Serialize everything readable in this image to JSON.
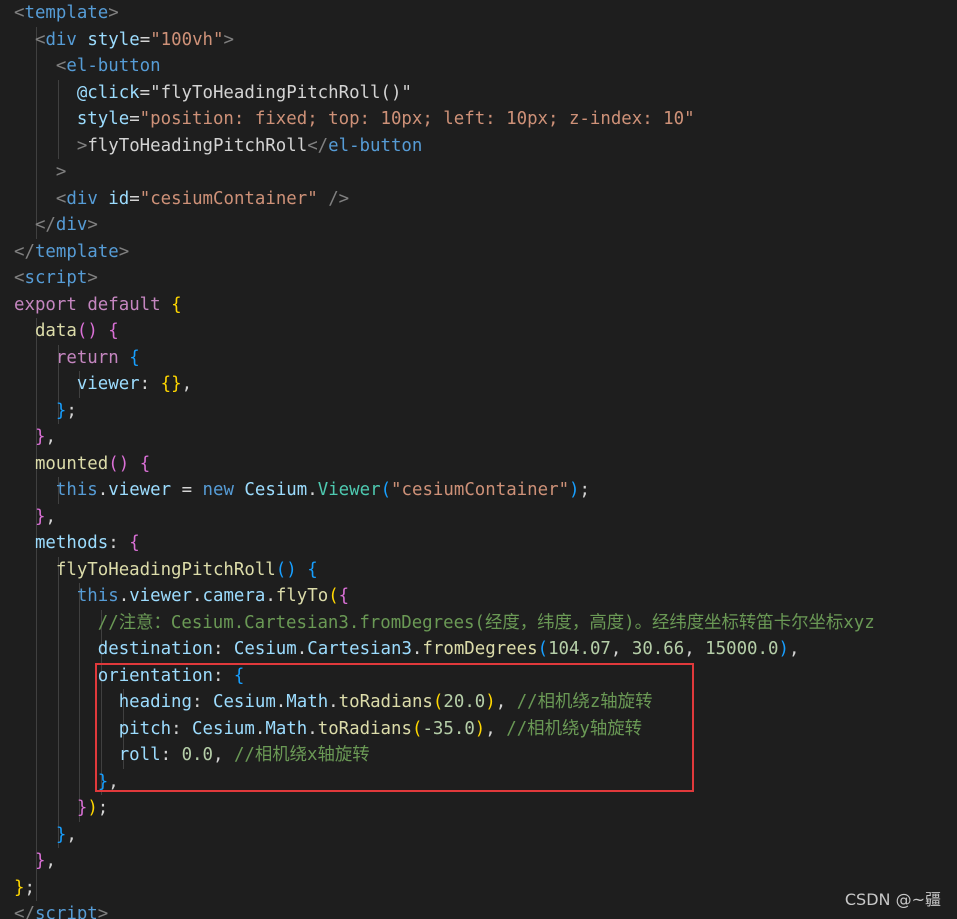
{
  "colors": {
    "background": "#1e1e1e",
    "tag_bracket": "#808080",
    "tag": "#569cd6",
    "attr": "#9cdcfe",
    "string": "#ce9178",
    "text": "#d4d4d4",
    "keyword": "#569cd6",
    "control": "#c586c0",
    "function": "#dcdcaa",
    "class": "#4ec9b0",
    "number": "#b5cea8",
    "comment": "#6a9955",
    "brace1": "#ffd700",
    "brace2": "#da70d6",
    "brace3": "#179fff",
    "highlight_border": "#e0393b"
  },
  "code_lines": [
    [
      [
        "<",
        "tag_bracket"
      ],
      [
        "template",
        "tag"
      ],
      [
        ">",
        "tag_bracket"
      ]
    ],
    [
      [
        "  "
      ],
      [
        "<",
        "tag_bracket"
      ],
      [
        "div",
        "tag"
      ],
      [
        " "
      ],
      [
        "style",
        "attr"
      ],
      [
        "=",
        "text"
      ],
      [
        "\"100vh\"",
        "string"
      ],
      [
        ">",
        "tag_bracket"
      ]
    ],
    [
      [
        "    "
      ],
      [
        "<",
        "tag_bracket"
      ],
      [
        "el-button",
        "tag"
      ]
    ],
    [
      [
        "      "
      ],
      [
        "@click",
        "attr"
      ],
      [
        "=",
        "text"
      ],
      [
        "\"flyToHeadingPitchRoll()\"",
        "text"
      ]
    ],
    [
      [
        "      "
      ],
      [
        "style",
        "attr"
      ],
      [
        "=",
        "text"
      ],
      [
        "\"position: fixed; top: 10px; left: 10px; z-index: 10\"",
        "string"
      ]
    ],
    [
      [
        "      "
      ],
      [
        ">",
        "tag_bracket"
      ],
      [
        "flyToHeadingPitchRoll",
        "text"
      ],
      [
        "</",
        "tag_bracket"
      ],
      [
        "el-button",
        "tag"
      ]
    ],
    [
      [
        "    "
      ],
      [
        ">",
        "tag_bracket"
      ]
    ],
    [
      [
        "    "
      ],
      [
        "<",
        "tag_bracket"
      ],
      [
        "div",
        "tag"
      ],
      [
        " "
      ],
      [
        "id",
        "attr"
      ],
      [
        "=",
        "text"
      ],
      [
        "\"cesiumContainer\"",
        "string"
      ],
      [
        " "
      ],
      [
        "/>",
        "tag_bracket"
      ]
    ],
    [
      [
        "  "
      ],
      [
        "</",
        "tag_bracket"
      ],
      [
        "div",
        "tag"
      ],
      [
        ">",
        "tag_bracket"
      ]
    ],
    [
      [
        "</",
        "tag_bracket"
      ],
      [
        "template",
        "tag"
      ],
      [
        ">",
        "tag_bracket"
      ]
    ],
    [
      [
        "<",
        "tag_bracket"
      ],
      [
        "script",
        "tag"
      ],
      [
        ">",
        "tag_bracket"
      ]
    ],
    [
      [
        "export",
        "control"
      ],
      [
        " "
      ],
      [
        "default",
        "control"
      ],
      [
        " "
      ],
      [
        "{",
        "brace1"
      ]
    ],
    [
      [
        "  "
      ],
      [
        "data",
        "function"
      ],
      [
        "()",
        "brace2"
      ],
      [
        " "
      ],
      [
        "{",
        "brace2"
      ]
    ],
    [
      [
        "    "
      ],
      [
        "return",
        "control"
      ],
      [
        " "
      ],
      [
        "{",
        "brace3"
      ]
    ],
    [
      [
        "      "
      ],
      [
        "viewer",
        "attr"
      ],
      [
        ":",
        "text"
      ],
      [
        " "
      ],
      [
        "{}",
        "brace1"
      ],
      [
        ",",
        "text"
      ]
    ],
    [
      [
        "    "
      ],
      [
        "}",
        "brace3"
      ],
      [
        ";",
        "text"
      ]
    ],
    [
      [
        "  "
      ],
      [
        "}",
        "brace2"
      ],
      [
        ",",
        "text"
      ]
    ],
    [
      [
        "  "
      ],
      [
        "mounted",
        "function"
      ],
      [
        "()",
        "brace2"
      ],
      [
        " "
      ],
      [
        "{",
        "brace2"
      ]
    ],
    [
      [
        "    "
      ],
      [
        "this",
        "keyword"
      ],
      [
        ".",
        "text"
      ],
      [
        "viewer",
        "attr"
      ],
      [
        " = ",
        "text"
      ],
      [
        "new",
        "keyword"
      ],
      [
        " "
      ],
      [
        "Cesium",
        "attr"
      ],
      [
        ".",
        "text"
      ],
      [
        "Viewer",
        "class"
      ],
      [
        "(",
        "brace3"
      ],
      [
        "\"cesiumContainer\"",
        "string"
      ],
      [
        ")",
        "brace3"
      ],
      [
        ";",
        "text"
      ]
    ],
    [
      [
        "  "
      ],
      [
        "}",
        "brace2"
      ],
      [
        ",",
        "text"
      ]
    ],
    [
      [
        "  "
      ],
      [
        "methods",
        "attr"
      ],
      [
        ":",
        "text"
      ],
      [
        " "
      ],
      [
        "{",
        "brace2"
      ]
    ],
    [
      [
        "    "
      ],
      [
        "flyToHeadingPitchRoll",
        "function"
      ],
      [
        "()",
        "brace3"
      ],
      [
        " "
      ],
      [
        "{",
        "brace3"
      ]
    ],
    [
      [
        "      "
      ],
      [
        "this",
        "keyword"
      ],
      [
        ".",
        "text"
      ],
      [
        "viewer",
        "attr"
      ],
      [
        ".",
        "text"
      ],
      [
        "camera",
        "attr"
      ],
      [
        ".",
        "text"
      ],
      [
        "flyTo",
        "function"
      ],
      [
        "(",
        "brace1"
      ],
      [
        "{",
        "brace2"
      ]
    ],
    [
      [
        "        "
      ],
      [
        "//注意：Cesium.Cartesian3.fromDegrees(经度，纬度，高度)。经纬度坐标转笛卡尔坐标xyz",
        "comment"
      ]
    ],
    [
      [
        "        "
      ],
      [
        "destination",
        "attr"
      ],
      [
        ":",
        "text"
      ],
      [
        " "
      ],
      [
        "Cesium",
        "attr"
      ],
      [
        ".",
        "text"
      ],
      [
        "Cartesian3",
        "attr"
      ],
      [
        ".",
        "text"
      ],
      [
        "fromDegrees",
        "function"
      ],
      [
        "(",
        "brace3"
      ],
      [
        "104.07",
        "number"
      ],
      [
        ", ",
        "text"
      ],
      [
        "30.66",
        "number"
      ],
      [
        ", ",
        "text"
      ],
      [
        "15000.0",
        "number"
      ],
      [
        ")",
        "brace3"
      ],
      [
        ",",
        "text"
      ]
    ],
    [
      [
        "        "
      ],
      [
        "orientation",
        "attr"
      ],
      [
        ":",
        "text"
      ],
      [
        " "
      ],
      [
        "{",
        "brace3"
      ]
    ],
    [
      [
        "          "
      ],
      [
        "heading",
        "attr"
      ],
      [
        ":",
        "text"
      ],
      [
        " "
      ],
      [
        "Cesium",
        "attr"
      ],
      [
        ".",
        "text"
      ],
      [
        "Math",
        "attr"
      ],
      [
        ".",
        "text"
      ],
      [
        "toRadians",
        "function"
      ],
      [
        "(",
        "brace1"
      ],
      [
        "20.0",
        "number"
      ],
      [
        ")",
        "brace1"
      ],
      [
        ", ",
        "text"
      ],
      [
        "//相机绕z轴旋转",
        "comment"
      ]
    ],
    [
      [
        "          "
      ],
      [
        "pitch",
        "attr"
      ],
      [
        ":",
        "text"
      ],
      [
        " "
      ],
      [
        "Cesium",
        "attr"
      ],
      [
        ".",
        "text"
      ],
      [
        "Math",
        "attr"
      ],
      [
        ".",
        "text"
      ],
      [
        "toRadians",
        "function"
      ],
      [
        "(",
        "brace1"
      ],
      [
        "-35.0",
        "number"
      ],
      [
        ")",
        "brace1"
      ],
      [
        ", ",
        "text"
      ],
      [
        "//相机绕y轴旋转",
        "comment"
      ]
    ],
    [
      [
        "          "
      ],
      [
        "roll",
        "attr"
      ],
      [
        ":",
        "text"
      ],
      [
        " "
      ],
      [
        "0.0",
        "number"
      ],
      [
        ", ",
        "text"
      ],
      [
        "//相机绕x轴旋转",
        "comment"
      ]
    ],
    [
      [
        "        "
      ],
      [
        "}",
        "brace3"
      ],
      [
        ",",
        "text"
      ]
    ],
    [
      [
        "      "
      ],
      [
        "}",
        "brace2"
      ],
      [
        ")",
        "brace1"
      ],
      [
        ";",
        "text"
      ]
    ],
    [
      [
        "    "
      ],
      [
        "}",
        "brace3"
      ],
      [
        ",",
        "text"
      ]
    ],
    [
      [
        "  "
      ],
      [
        "}",
        "brace2"
      ],
      [
        ",",
        "text"
      ]
    ],
    [
      [
        "}",
        "brace1"
      ],
      [
        ";",
        "text"
      ]
    ],
    [
      [
        "</",
        "tag_bracket"
      ],
      [
        "script",
        "tag"
      ],
      [
        ">",
        "tag_bracket"
      ]
    ]
  ],
  "watermark": "CSDN @~疆"
}
